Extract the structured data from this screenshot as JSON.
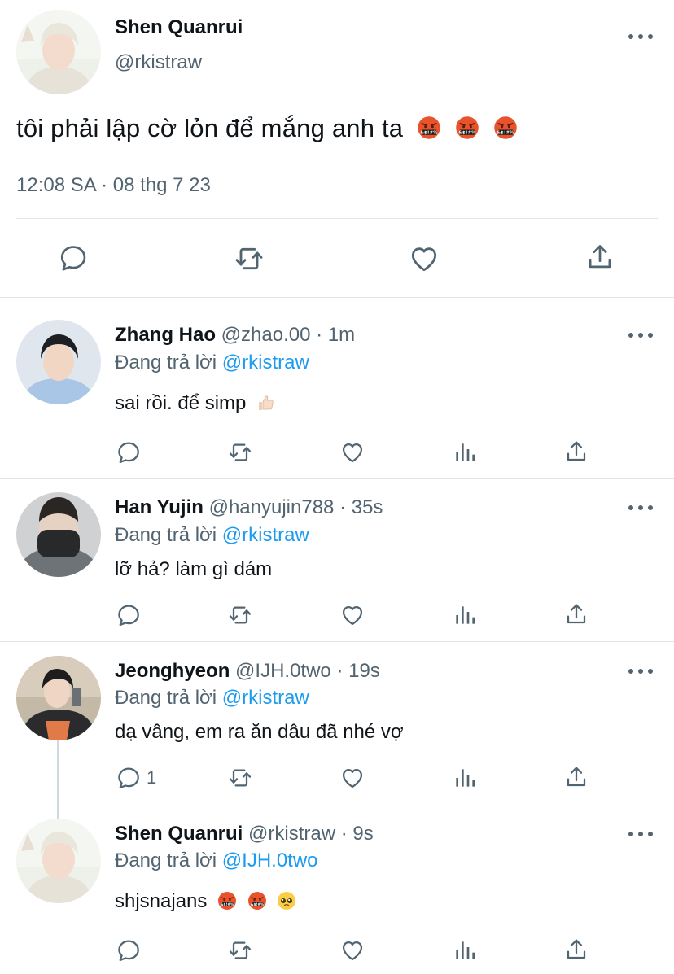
{
  "main_tweet": {
    "author_name": "Shen Quanrui",
    "author_handle": "@rkistraw",
    "text": "tôi phải lập cờ lỏn để mắng anh ta",
    "emojis": [
      "cursing-face",
      "cursing-face",
      "cursing-face"
    ],
    "timestamp": "12:08 SA · 08 thg 7 23",
    "actions": [
      "reply-icon",
      "retweet-icon",
      "like-icon",
      "share-icon"
    ]
  },
  "replies": [
    {
      "name": "Zhang Hao",
      "handle": "@zhao.00",
      "time": "· 1m",
      "replying_prefix": "Đang trả lời ",
      "replying_to": "@rkistraw",
      "text": "sai rồi. để simp",
      "emojis": [
        "thumbs-up-light-skin"
      ],
      "reply_count": ""
    },
    {
      "name": "Han Yujin",
      "handle": "@hanyujin788",
      "time": "· 35s",
      "replying_prefix": "Đang trả lời ",
      "replying_to": "@rkistraw",
      "text": "lỡ hả? làm gì dám",
      "emojis": [],
      "reply_count": ""
    },
    {
      "name": "Jeonghyeon",
      "handle": "@IJH.0two",
      "time": "· 19s",
      "replying_prefix": "Đang trả lời ",
      "replying_to": "@rkistraw",
      "text": "dạ vâng, em ra ăn dâu đã nhé vợ",
      "emojis": [],
      "reply_count": "1"
    },
    {
      "name": "Shen Quanrui",
      "handle": "@rkistraw",
      "time": "· 9s",
      "replying_prefix": "Đang trả lời ",
      "replying_to": "@IJH.0two",
      "text": "shjsnajans",
      "emojis": [
        "cursing-face",
        "cursing-face",
        "pleading-face"
      ],
      "reply_count": ""
    }
  ],
  "reply_actions": [
    "reply-icon",
    "retweet-icon",
    "like-icon",
    "views-icon",
    "share-icon"
  ],
  "colors": {
    "text": "#0f1419",
    "secondary": "#536471",
    "mention": "#1d9bf0",
    "divider": "#e1e6ea"
  }
}
